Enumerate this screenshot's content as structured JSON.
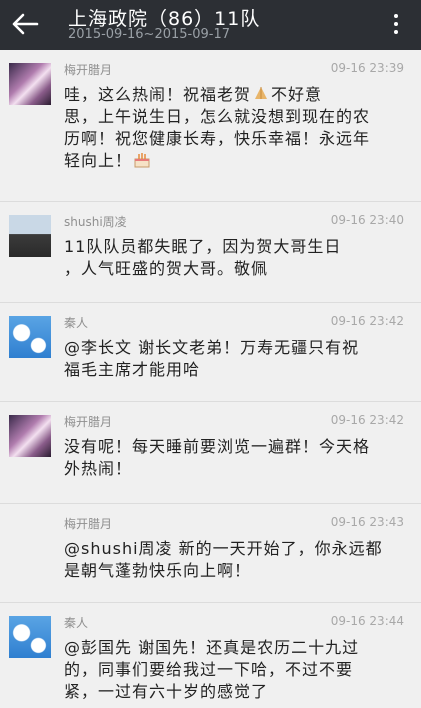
{
  "header": {
    "title": "上海政院（86）11队",
    "subtitle": "2015-09-16~2015-09-17"
  },
  "messages": [
    {
      "name": "梅开腊月",
      "time": "09-16 23:39",
      "lines": [
        "哇，这么热闹！祝福老贺",
        "不好意",
        "思，上午说生日，怎么就没想到现在的农",
        "历啊！祝您健康长寿，快乐幸福！永远年",
        "轻向上！"
      ],
      "avatar": "flower-avatar"
    },
    {
      "name": "shushi周凌",
      "time": "09-16 23:40",
      "lines": [
        "11队队员都失眠了，因为贺大哥生日",
        "，人气旺盛的贺大哥。敬佩"
      ],
      "avatar": "person-avatar"
    },
    {
      "name": "秦人",
      "time": "09-16 23:42",
      "lines": [
        "@李长文 谢长文老弟！万寿无疆只有祝",
        "福毛主席才能用哈"
      ],
      "avatar": "sky-avatar"
    },
    {
      "name": "梅开腊月",
      "time": "09-16 23:42",
      "lines": [
        "没有呢！每天睡前要浏览一遍群！今天格",
        "外热闹！"
      ],
      "avatar": "flower-avatar"
    },
    {
      "name": "梅开腊月",
      "time": "09-16 23:43",
      "lines": [
        "@shushi周凌 新的一天开始了，你永远都",
        "是朝气蓬勃快乐向上啊！"
      ],
      "avatar": ""
    },
    {
      "name": "秦人",
      "time": "09-16 23:44",
      "lines": [
        "@彭国先 谢国先！还真是农历二十九过",
        "的，同事们要给我过一下哈，不过不要",
        "紧，一过有六十岁的感觉了"
      ],
      "avatar": "sky-avatar"
    }
  ]
}
